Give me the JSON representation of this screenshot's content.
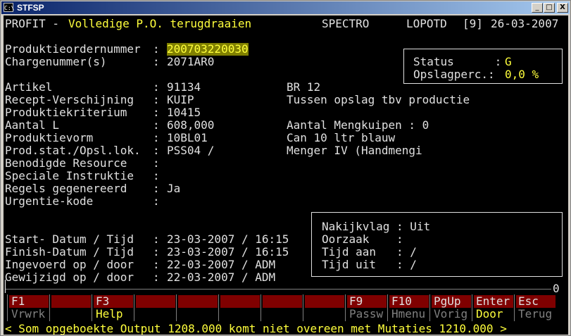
{
  "window": {
    "title": "STFSP",
    "icon_label": "C:\\",
    "controls": {
      "minimize": "_",
      "maximize": "□",
      "close": "X"
    }
  },
  "header": {
    "app": "PROFIT - ",
    "function": "Volledige P.O. terugdraaien",
    "company": "SPECTRO",
    "user": "LOPOTD",
    "session": "[9]",
    "date": "26-03-2007"
  },
  "fields": {
    "order_label": "Produktieordernummer",
    "order_value": "200703220030",
    "charge_label": "Chargenummer(s)",
    "charge_value": "2071AR0",
    "artikel_label": "Artikel",
    "artikel_value": "91134",
    "artikel_extra": "BR 12",
    "recept_label": "Recept-Verschijning",
    "recept_value": "KUIP",
    "recept_extra": "Tussen opslag tbv productie",
    "kriterium_label": "Produktiekriterium",
    "kriterium_value": "10415",
    "aantal_label": "Aantal L",
    "aantal_value": "608,000",
    "mengkuipen_label": "Aantal Mengkuipen : 0",
    "vorm_label": "Produktievorm",
    "vorm_value": "10BL01",
    "vorm_extra": "Can 10 ltr blauw",
    "stat_label": "Prod.stat./Opsl.lok.",
    "stat_value": "PSS04 /",
    "stat_extra": "Menger IV (Handmengi",
    "resource_label": "Benodigde Resource",
    "resource_value": "",
    "instructie_label": "Speciale Instruktie",
    "instructie_value": "",
    "regels_label": "Regels gegenereerd",
    "regels_value": "Ja",
    "urgentie_label": "Urgentie-kode",
    "urgentie_value": "",
    "start_label": "Start- Datum / Tijd",
    "start_value": "23-03-2007 / 16:15",
    "finish_label": "Finish-Datum / Tijd",
    "finish_value": "23-03-2007 / 16:15",
    "ingevoerd_label": "Ingevoerd op / door",
    "ingevoerd_value": "22-03-2007 / ADM",
    "gewijzigd_label": "Gewijzigd op / door",
    "gewijzigd_value": "22-03-2007 / ADM"
  },
  "status_box": {
    "status_label": "Status      :",
    "status_value": "G",
    "opslag_label": "Opslagperc.:",
    "opslag_value": "0,0 %"
  },
  "nakijk_box": {
    "nakijk": "Nakijkvlag : Uit",
    "oorzaak": "Oorzaak    :",
    "tijd_aan": "Tijd aan   : /",
    "tijd_uit": "Tijd uit   : /"
  },
  "scroll_indicator": "0",
  "fkeys": [
    {
      "key": "F1",
      "desc": "Vrwrk"
    },
    {
      "key": "",
      "desc": ""
    },
    {
      "key": "F3",
      "desc": "Help"
    },
    {
      "key": "",
      "desc": ""
    },
    {
      "key": "",
      "desc": ""
    },
    {
      "key": "",
      "desc": ""
    },
    {
      "key": "",
      "desc": ""
    },
    {
      "key": "",
      "desc": ""
    },
    {
      "key": "F9",
      "desc": "Passw"
    },
    {
      "key": "F10",
      "desc": "Hmenu"
    },
    {
      "key": "PgUp",
      "desc": "Vorig"
    },
    {
      "key": "Enter",
      "desc": "Door"
    },
    {
      "key": "Esc",
      "desc": "Terug"
    }
  ],
  "message": "< Som opgeboekte Output 1208.000 komt niet overeen met Mutaties 1210.000 >",
  "colors": {
    "background": "#000000",
    "text": "#e0e0e0",
    "highlight": "#ffff3c",
    "fkey_bar": "#800000",
    "titlebar_start": "#0a246a"
  }
}
